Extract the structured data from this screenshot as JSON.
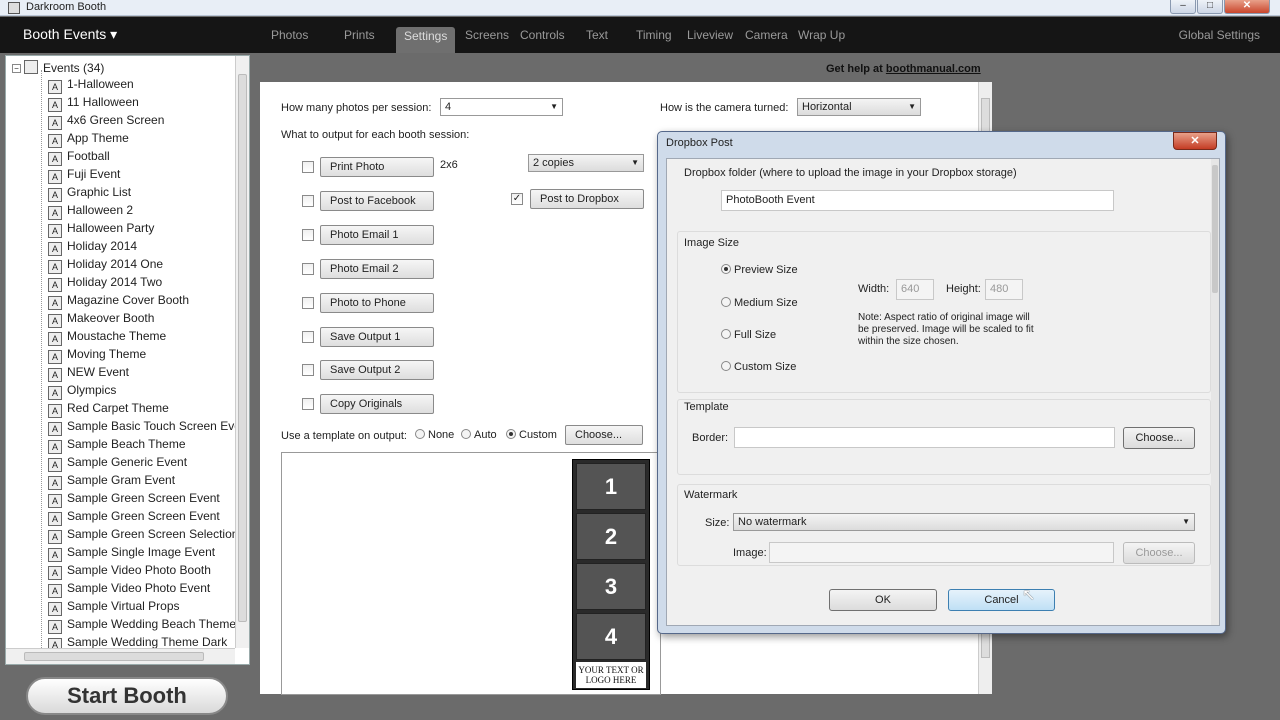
{
  "window": {
    "title": "Darkroom Booth",
    "controls": {
      "minimize": "–",
      "maximize": "□",
      "close": "✕"
    }
  },
  "menubar": {
    "booth_events": "Booth Events ▾",
    "tabs": [
      "Photos",
      "Prints",
      "Settings",
      "Screens",
      "Controls",
      "Text",
      "Timing",
      "Liveview",
      "Camera",
      "Wrap Up"
    ],
    "active_tab": "Settings",
    "global_settings": "Global Settings"
  },
  "events_tree": {
    "root_label": "Events (34)",
    "items": [
      "1-Halloween",
      "11 Halloween",
      "4x6 Green Screen",
      "App Theme",
      "Football",
      "Fuji Event",
      "Graphic List",
      "Halloween 2",
      "Halloween Party",
      "Holiday 2014",
      "Holiday 2014 One",
      "Holiday 2014 Two",
      "Magazine Cover Booth",
      "Makeover Booth",
      "Moustache Theme",
      "Moving Theme",
      "NEW Event",
      "Olympics",
      "Red Carpet Theme",
      "Sample Basic Touch Screen Eve",
      "Sample Beach Theme",
      "Sample Generic Event",
      "Sample Gram Event",
      "Sample Green Screen Event",
      "Sample Green Screen Event",
      "Sample Green Screen Selection",
      "Sample Single Image Event",
      "Sample Video Photo Booth",
      "Sample Video Photo Event",
      "Sample Virtual Props",
      "Sample Wedding Beach Theme",
      "Sample Wedding Theme Dark"
    ]
  },
  "start_booth": "Start Booth",
  "help": {
    "prefix": "Get help at ",
    "link": "boothmanual.com"
  },
  "settings": {
    "photos_per_session_label": "How many photos per session:",
    "photos_per_session_value": "4",
    "camera_turned_label": "How is the camera turned:",
    "camera_turned_value": "Horizontal",
    "output_label": "What to output for each booth session:",
    "outputs": [
      {
        "label": "Print Photo",
        "checked": false
      },
      {
        "label": "Post to Facebook",
        "checked": false
      },
      {
        "label": "Photo Email 1",
        "checked": false
      },
      {
        "label": "Photo Email 2",
        "checked": false
      },
      {
        "label": "Photo to Phone",
        "checked": false
      },
      {
        "label": "Save Output 1",
        "checked": false
      },
      {
        "label": "Save Output 2",
        "checked": false
      },
      {
        "label": "Copy Originals",
        "checked": false
      }
    ],
    "print_size": "2x6",
    "copies_value": "2 copies",
    "dropbox_button": "Post to Dropbox",
    "dropbox_check": "✓",
    "template_label": "Use a template on output:",
    "template_options": [
      "None",
      "Auto",
      "Custom"
    ],
    "template_selected": "Custom",
    "choose_button": "Choose...",
    "strip_frames": [
      "1",
      "2",
      "3",
      "4"
    ],
    "strip_footer_line1": "YOUR TEXT OR",
    "strip_footer_line2": "LOGO HERE"
  },
  "dialog": {
    "title": "Dropbox Post",
    "close_label": "✕",
    "folder_label": "Dropbox folder (where to upload the image in your Dropbox storage)",
    "folder_value": "PhotoBooth Event",
    "image_size_heading": "Image Size",
    "size_options": [
      "Preview Size",
      "Medium Size",
      "Full Size",
      "Custom Size"
    ],
    "size_selected": "Preview Size",
    "width_label": "Width:",
    "width_value": "640",
    "height_label": "Height:",
    "height_value": "480",
    "note": "Note: Aspect ratio of original image will be preserved. Image will be scaled to fit within the size chosen.",
    "template_heading": "Template",
    "border_label": "Border:",
    "border_value": "",
    "border_choose": "Choose...",
    "watermark_heading": "Watermark",
    "wm_size_label": "Size:",
    "wm_size_value": "No watermark",
    "wm_image_label": "Image:",
    "wm_image_value": "",
    "wm_choose": "Choose...",
    "ok": "OK",
    "cancel": "Cancel"
  }
}
